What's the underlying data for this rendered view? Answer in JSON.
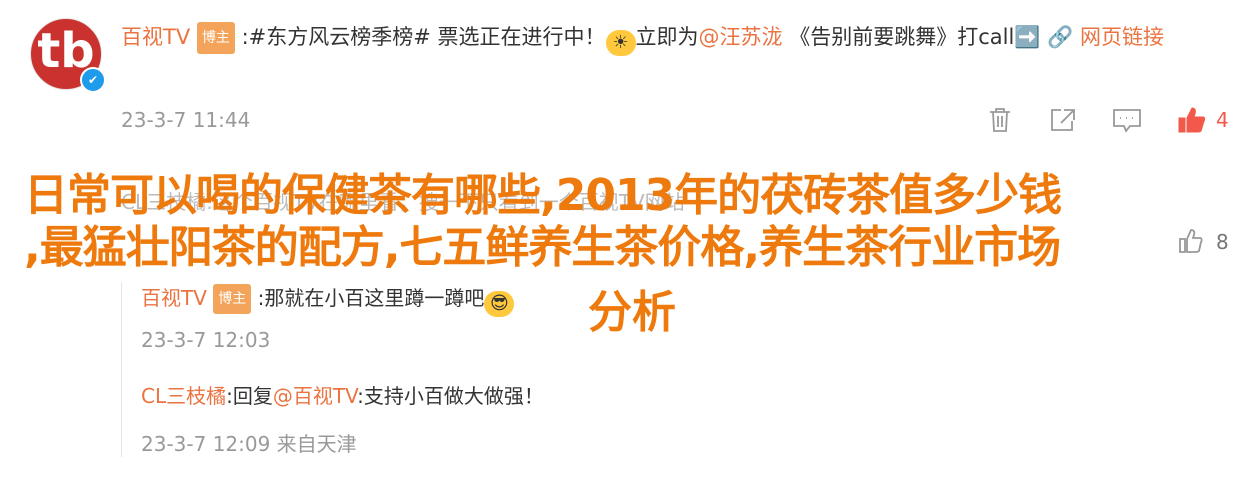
{
  "post": {
    "author": "百视TV",
    "author_tag": "博主",
    "text_prefix": ":#东方风云榜季榜#  票选正在进行中！",
    "emoji1": "☀",
    "text_mid": "立即为",
    "mention": "@汪苏泷",
    "text_suffix": " 《告别前要跳舞》打call➡️",
    "link_label": "🔗 网页链接",
    "timestamp": "23-3-7 11:44",
    "like_count": "4",
    "avatar_letter": "tb",
    "verified_icon": "✔"
  },
  "faded_comment": {
    "author": "CL三枝橘",
    "text": "这个百视TV在哪里看，搜一下只看到一个百视TV网站",
    "like_count": "8"
  },
  "replies": [
    {
      "author": "百视TV",
      "author_tag": "博主",
      "text": ":那就在小百这里蹲一蹲吧",
      "emoji": "😎",
      "timestamp": "23-3-7 12:03"
    },
    {
      "author": "CL三枝橘",
      "text_prefix": ":回复",
      "mention": "@百视TV",
      "text_suffix": ":支持小百做大做强！",
      "timestamp": "23-3-7 12:09 来自天津"
    }
  ],
  "headline": {
    "line1": "日常可以喝的保健茶有哪些,2013年的茯砖茶值多少钱",
    "line2": ",最猛壮阳茶的配方,七五鲜养生茶价格,养生茶行业市场",
    "line3": "分析"
  },
  "colors": {
    "accent": "#eb7340",
    "headline": "#ee7a0d",
    "like_red": "#f2594b",
    "muted": "#999999"
  }
}
